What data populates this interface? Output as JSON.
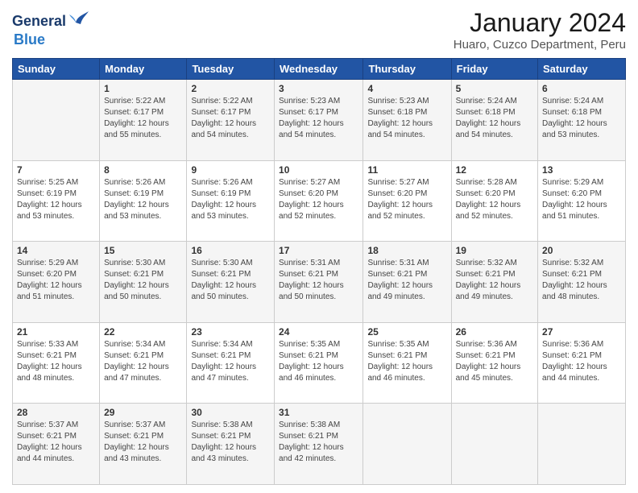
{
  "logo": {
    "line1": "General",
    "line2": "Blue"
  },
  "title": "January 2024",
  "subtitle": "Huaro, Cuzco Department, Peru",
  "weekdays": [
    "Sunday",
    "Monday",
    "Tuesday",
    "Wednesday",
    "Thursday",
    "Friday",
    "Saturday"
  ],
  "weeks": [
    [
      {
        "day": "",
        "info": ""
      },
      {
        "day": "1",
        "info": "Sunrise: 5:22 AM\nSunset: 6:17 PM\nDaylight: 12 hours\nand 55 minutes."
      },
      {
        "day": "2",
        "info": "Sunrise: 5:22 AM\nSunset: 6:17 PM\nDaylight: 12 hours\nand 54 minutes."
      },
      {
        "day": "3",
        "info": "Sunrise: 5:23 AM\nSunset: 6:17 PM\nDaylight: 12 hours\nand 54 minutes."
      },
      {
        "day": "4",
        "info": "Sunrise: 5:23 AM\nSunset: 6:18 PM\nDaylight: 12 hours\nand 54 minutes."
      },
      {
        "day": "5",
        "info": "Sunrise: 5:24 AM\nSunset: 6:18 PM\nDaylight: 12 hours\nand 54 minutes."
      },
      {
        "day": "6",
        "info": "Sunrise: 5:24 AM\nSunset: 6:18 PM\nDaylight: 12 hours\nand 53 minutes."
      }
    ],
    [
      {
        "day": "7",
        "info": "Sunrise: 5:25 AM\nSunset: 6:19 PM\nDaylight: 12 hours\nand 53 minutes."
      },
      {
        "day": "8",
        "info": "Sunrise: 5:26 AM\nSunset: 6:19 PM\nDaylight: 12 hours\nand 53 minutes."
      },
      {
        "day": "9",
        "info": "Sunrise: 5:26 AM\nSunset: 6:19 PM\nDaylight: 12 hours\nand 53 minutes."
      },
      {
        "day": "10",
        "info": "Sunrise: 5:27 AM\nSunset: 6:20 PM\nDaylight: 12 hours\nand 52 minutes."
      },
      {
        "day": "11",
        "info": "Sunrise: 5:27 AM\nSunset: 6:20 PM\nDaylight: 12 hours\nand 52 minutes."
      },
      {
        "day": "12",
        "info": "Sunrise: 5:28 AM\nSunset: 6:20 PM\nDaylight: 12 hours\nand 52 minutes."
      },
      {
        "day": "13",
        "info": "Sunrise: 5:29 AM\nSunset: 6:20 PM\nDaylight: 12 hours\nand 51 minutes."
      }
    ],
    [
      {
        "day": "14",
        "info": "Sunrise: 5:29 AM\nSunset: 6:20 PM\nDaylight: 12 hours\nand 51 minutes."
      },
      {
        "day": "15",
        "info": "Sunrise: 5:30 AM\nSunset: 6:21 PM\nDaylight: 12 hours\nand 50 minutes."
      },
      {
        "day": "16",
        "info": "Sunrise: 5:30 AM\nSunset: 6:21 PM\nDaylight: 12 hours\nand 50 minutes."
      },
      {
        "day": "17",
        "info": "Sunrise: 5:31 AM\nSunset: 6:21 PM\nDaylight: 12 hours\nand 50 minutes."
      },
      {
        "day": "18",
        "info": "Sunrise: 5:31 AM\nSunset: 6:21 PM\nDaylight: 12 hours\nand 49 minutes."
      },
      {
        "day": "19",
        "info": "Sunrise: 5:32 AM\nSunset: 6:21 PM\nDaylight: 12 hours\nand 49 minutes."
      },
      {
        "day": "20",
        "info": "Sunrise: 5:32 AM\nSunset: 6:21 PM\nDaylight: 12 hours\nand 48 minutes."
      }
    ],
    [
      {
        "day": "21",
        "info": "Sunrise: 5:33 AM\nSunset: 6:21 PM\nDaylight: 12 hours\nand 48 minutes."
      },
      {
        "day": "22",
        "info": "Sunrise: 5:34 AM\nSunset: 6:21 PM\nDaylight: 12 hours\nand 47 minutes."
      },
      {
        "day": "23",
        "info": "Sunrise: 5:34 AM\nSunset: 6:21 PM\nDaylight: 12 hours\nand 47 minutes."
      },
      {
        "day": "24",
        "info": "Sunrise: 5:35 AM\nSunset: 6:21 PM\nDaylight: 12 hours\nand 46 minutes."
      },
      {
        "day": "25",
        "info": "Sunrise: 5:35 AM\nSunset: 6:21 PM\nDaylight: 12 hours\nand 46 minutes."
      },
      {
        "day": "26",
        "info": "Sunrise: 5:36 AM\nSunset: 6:21 PM\nDaylight: 12 hours\nand 45 minutes."
      },
      {
        "day": "27",
        "info": "Sunrise: 5:36 AM\nSunset: 6:21 PM\nDaylight: 12 hours\nand 44 minutes."
      }
    ],
    [
      {
        "day": "28",
        "info": "Sunrise: 5:37 AM\nSunset: 6:21 PM\nDaylight: 12 hours\nand 44 minutes."
      },
      {
        "day": "29",
        "info": "Sunrise: 5:37 AM\nSunset: 6:21 PM\nDaylight: 12 hours\nand 43 minutes."
      },
      {
        "day": "30",
        "info": "Sunrise: 5:38 AM\nSunset: 6:21 PM\nDaylight: 12 hours\nand 43 minutes."
      },
      {
        "day": "31",
        "info": "Sunrise: 5:38 AM\nSunset: 6:21 PM\nDaylight: 12 hours\nand 42 minutes."
      },
      {
        "day": "",
        "info": ""
      },
      {
        "day": "",
        "info": ""
      },
      {
        "day": "",
        "info": ""
      }
    ]
  ]
}
